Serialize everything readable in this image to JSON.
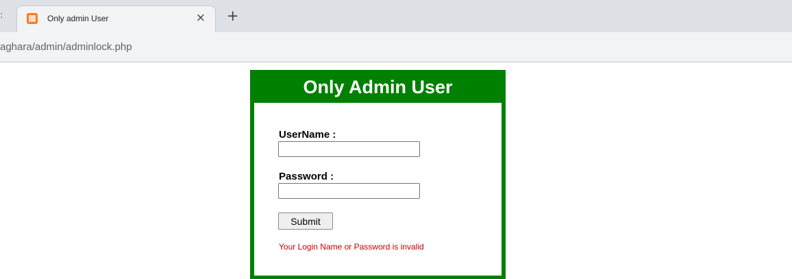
{
  "browser": {
    "tab_edge_glyph": ":",
    "tab_title": "Only admin User",
    "tab_close_glyph": "×",
    "new_tab_glyph": "+",
    "url": "aghara/admin/adminlock.php",
    "favicon_icon": "xampp-logo-icon",
    "favicon_color": "#fb7a24"
  },
  "login": {
    "title": "Only Admin User",
    "username_label": "UserName :",
    "username_value": "",
    "password_label": "Password :",
    "password_value": "",
    "submit_label": "Submit",
    "error_message": "Your Login Name or Password is invalid",
    "accent_color": "#008000",
    "error_color": "#c00000"
  }
}
